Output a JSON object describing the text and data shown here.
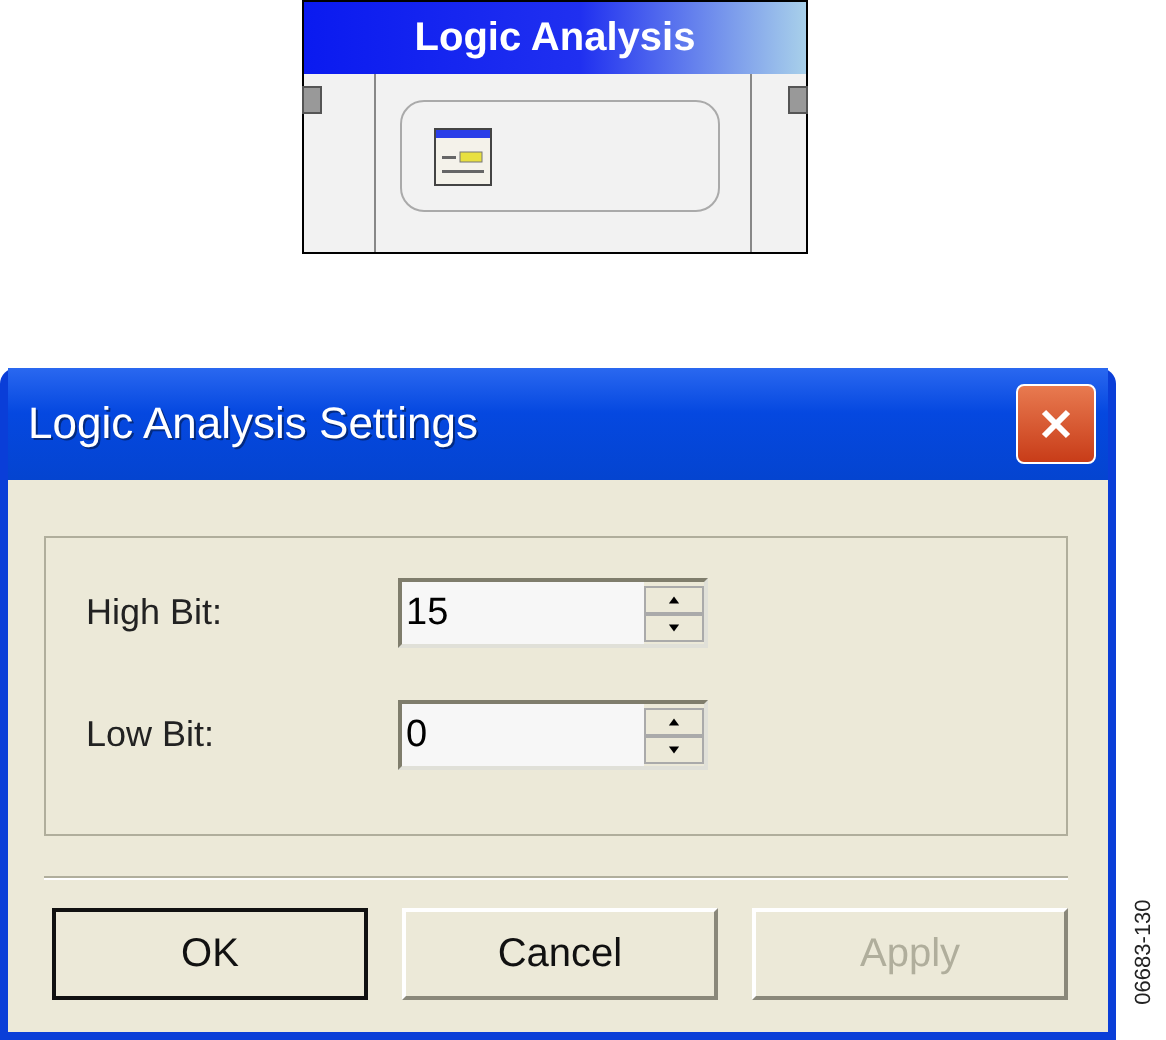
{
  "block": {
    "title": "Logic Analysis"
  },
  "dialog": {
    "title": "Logic Analysis Settings",
    "fields": [
      {
        "label": "High Bit:",
        "value": "15"
      },
      {
        "label": "Low Bit:",
        "value": "0"
      }
    ],
    "buttons": [
      {
        "label": "OK",
        "default": true,
        "disabled": false
      },
      {
        "label": "Cancel",
        "default": false,
        "disabled": false
      },
      {
        "label": "Apply",
        "default": false,
        "disabled": true
      }
    ]
  },
  "figure_number": "06683-130"
}
